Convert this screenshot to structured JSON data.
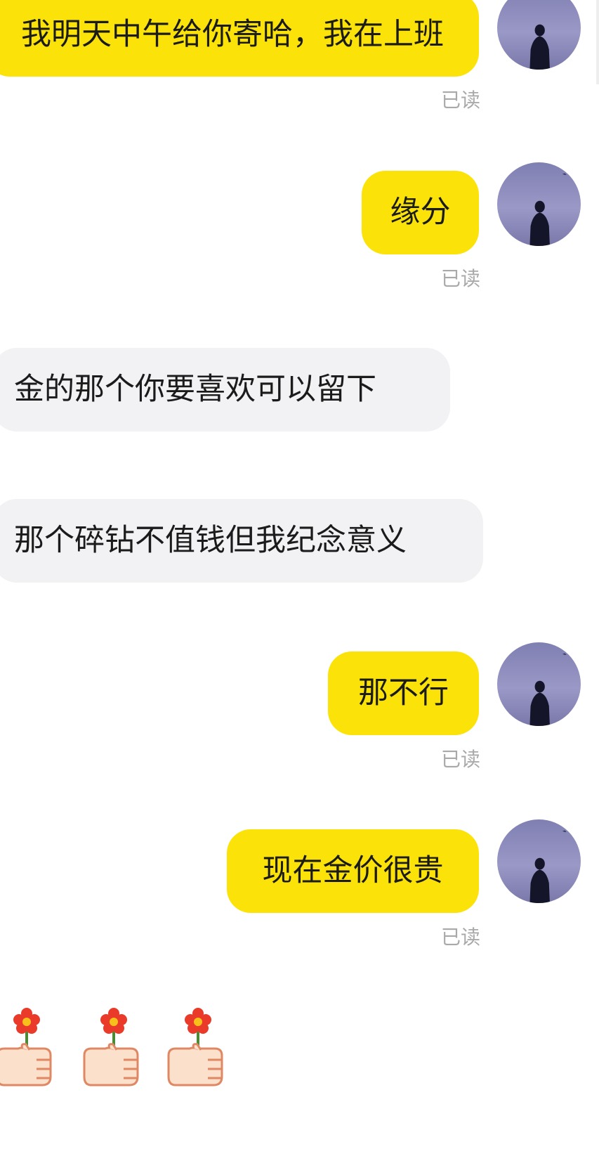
{
  "messages": [
    {
      "side": "sent",
      "text": "我明天中午给你寄哈，我在上班",
      "status": "已读"
    },
    {
      "side": "sent",
      "text": "缘分",
      "status": "已读"
    },
    {
      "side": "received",
      "text": "金的那个你要喜欢可以留下"
    },
    {
      "side": "received",
      "text": "那个碎钻不值钱但我纪念意义"
    },
    {
      "side": "sent",
      "text": "那不行",
      "status": "已读"
    },
    {
      "side": "sent",
      "text": "现在金价很贵",
      "status": "已读"
    }
  ],
  "emojis": [
    "hand-holding-flower-icon",
    "hand-holding-flower-icon",
    "hand-holding-flower-icon"
  ],
  "colors": {
    "sent_bubble": "#fbe309",
    "received_bubble": "#f2f2f4",
    "read_status": "#a9a9a9"
  }
}
